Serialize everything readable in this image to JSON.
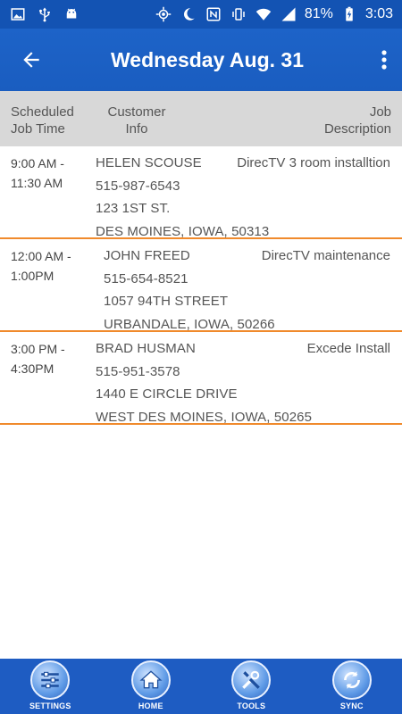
{
  "status_bar": {
    "battery_percent": "81%",
    "time": "3:03",
    "left_icons": [
      "image-icon",
      "usb-icon",
      "android-icon"
    ],
    "right_icons": [
      "gps-icon",
      "moon-icon",
      "nfc-icon",
      "vibrate-icon",
      "wifi-icon",
      "signal-icon",
      "battery-charging-icon"
    ]
  },
  "app_bar": {
    "title": "Wednesday Aug. 31",
    "back_icon": "arrow-back-icon",
    "menu_icon": "more-vert-icon"
  },
  "table_header": {
    "time_line1": "Scheduled",
    "time_line2": "Job Time",
    "customer_line1": "Customer",
    "customer_line2": "Info",
    "desc_line1": "Job",
    "desc_line2": "Description"
  },
  "jobs": [
    {
      "time_line1": "9:00 AM -",
      "time_line2": "11:30 AM",
      "name": "HELEN SCOUSE",
      "phone": "515-987-6543",
      "street": "123 1ST ST.",
      "city": "DES MOINES, IOWA, 50313",
      "description": "DirecTV 3 room installtion"
    },
    {
      "time_line1": "12:00 AM -",
      "time_line2": "1:00PM",
      "name": "JOHN FREED",
      "phone": "515-654-8521",
      "street": "1057 94TH STREET",
      "city": "URBANDALE, IOWA, 50266",
      "description": "DirecTV maintenance"
    },
    {
      "time_line1": "3:00 PM -",
      "time_line2": "4:30PM",
      "name": "BRAD HUSMAN",
      "phone": "515-951-3578",
      "street": "1440 E CIRCLE DRIVE",
      "city": "WEST DES MOINES, IOWA, 50265",
      "description": "Excede Install"
    }
  ],
  "bottom_nav": {
    "settings_label": "SETTINGS",
    "home_label": "HOME",
    "tools_label": "TOOLS",
    "sync_label": "SYNC"
  },
  "colors": {
    "primary": "#1a5dc0",
    "divider": "#f08a2c",
    "header_bg": "#d8d8d8"
  }
}
